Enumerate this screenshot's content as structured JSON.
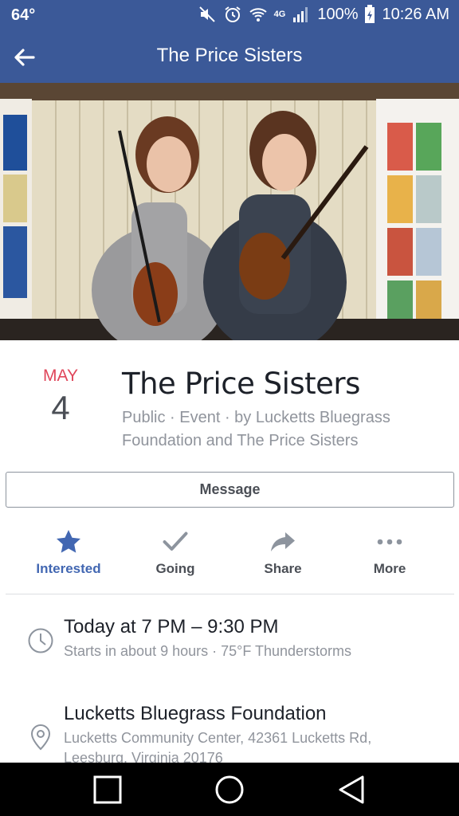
{
  "status_bar": {
    "temperature": "64°",
    "network": "4G",
    "battery": "100%",
    "time": "10:26 AM",
    "icons": [
      "mute-icon",
      "alarm-icon",
      "wifi-icon",
      "signal-icon",
      "battery-icon"
    ]
  },
  "app_bar": {
    "title": "The Price Sisters",
    "back_icon": "back-arrow-icon"
  },
  "event": {
    "month": "MAY",
    "day": "4",
    "title": "The Price Sisters",
    "subtitle": "Public · Event · by Lucketts Bluegrass Foundation and The Price Sisters"
  },
  "message_button": {
    "label": "Message"
  },
  "actions": [
    {
      "label": "Interested",
      "icon": "star-icon",
      "active": true
    },
    {
      "label": "Going",
      "icon": "check-icon",
      "active": false
    },
    {
      "label": "Share",
      "icon": "share-icon",
      "active": false
    },
    {
      "label": "More",
      "icon": "more-icon",
      "active": false
    }
  ],
  "time_info": {
    "main": "Today at 7 PM – 9:30 PM",
    "sub": "Starts in about 9 hours · 75°F Thunderstorms"
  },
  "location_info": {
    "main": "Lucketts Bluegrass Foundation",
    "sub1": "Lucketts Community Center, 42361 Lucketts Rd,",
    "sub2": "Leesburg, Virginia 20176"
  },
  "colors": {
    "brand": "#3b5998",
    "accent": "#4267b2",
    "month": "#e0475b"
  }
}
